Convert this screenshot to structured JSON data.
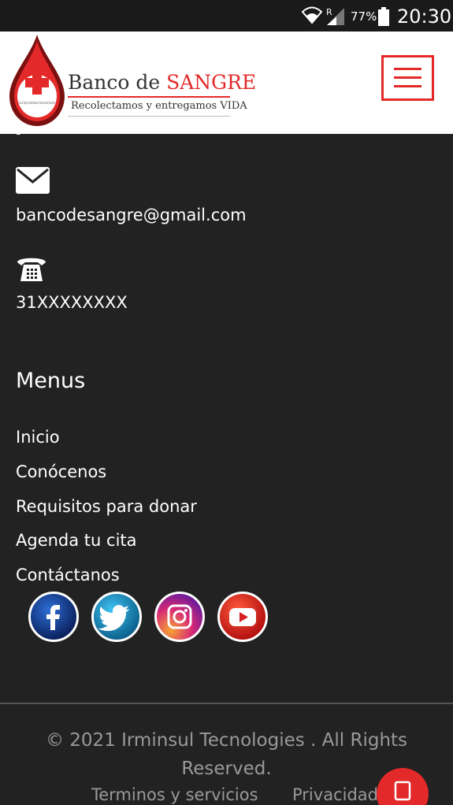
{
  "status_bar": {
    "battery_percent": "77%",
    "time": "20:30",
    "network_indicator": "R"
  },
  "header": {
    "brand_prefix": "Banco de ",
    "brand_accent": "SANGRE",
    "tagline": "Recolectamos y entregamos VIDA",
    "logo_caption": "Cruz Roja Colombiana Seccional Sonsón",
    "icons": {
      "logo": "blood-drop-red-cross-icon",
      "menu": "hamburger-menu-icon"
    }
  },
  "contact": {
    "partial_text": "s",
    "email": "bancodesangre@gmail.com",
    "phone": "31XXXXXXXX",
    "icons": {
      "email": "envelope-icon",
      "phone": "telephone-icon"
    }
  },
  "menus": {
    "heading": "Menus",
    "items": [
      {
        "label": "Inicio"
      },
      {
        "label": "Conócenos"
      },
      {
        "label": "Requisitos para donar"
      },
      {
        "label": "Agenda tu cita"
      },
      {
        "label": "Contáctanos"
      }
    ]
  },
  "social": [
    {
      "name": "facebook",
      "icon": "facebook-icon"
    },
    {
      "name": "twitter",
      "icon": "twitter-icon"
    },
    {
      "name": "instagram",
      "icon": "instagram-icon"
    },
    {
      "name": "youtube",
      "icon": "youtube-icon"
    }
  ],
  "footer": {
    "copyright": "© 2021 Irminsul Tecnologies . All Rights Reserved.",
    "links": [
      {
        "label": "Terminos y servicios"
      },
      {
        "label": "Privacidad"
      }
    ]
  },
  "colors": {
    "accent": "#e32929",
    "background": "#222222",
    "text": "#ffffff",
    "muted": "#999999"
  }
}
